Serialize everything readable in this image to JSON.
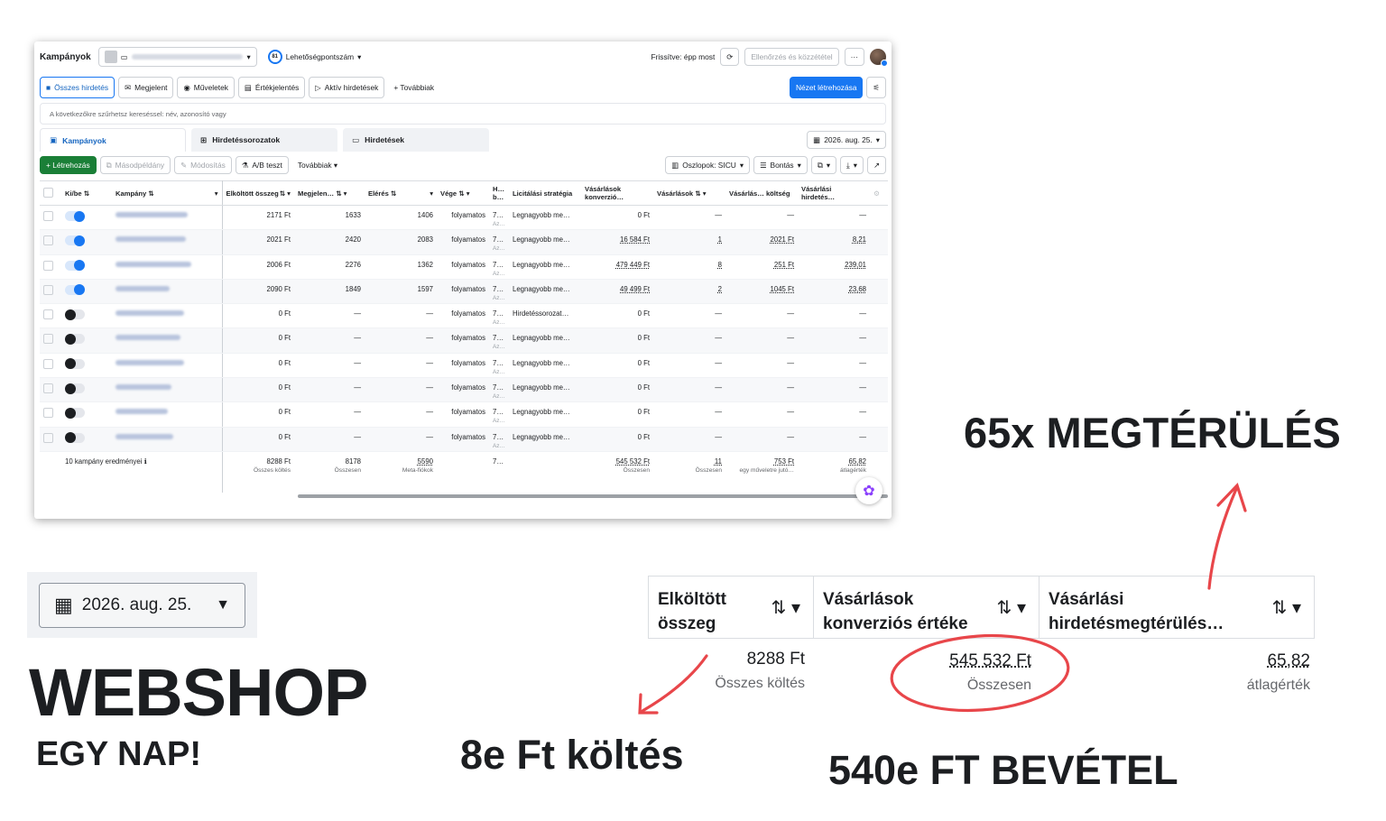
{
  "app": {
    "title": "Kampányok",
    "score_number": "81",
    "score_label": "Lehetőségpontszám",
    "refreshed": "Frissítve: épp most",
    "review_button": "Ellenőrzés és közzététel",
    "more_button": "···"
  },
  "filter_bar": {
    "all_ads": "Összes hirdetés",
    "appeared": "Megjelent",
    "actions": "Műveletek",
    "reports": "Értékjelentés",
    "active_ads": "Aktív hirdetések",
    "more": "+ Továbbiak",
    "create_view": "Nézet létrehozása"
  },
  "search": {
    "placeholder": "A következőkre szűrhetsz kereséssel: név, azonosító vagy"
  },
  "tabs": {
    "campaigns": "Kampányok",
    "adsets": "Hirdetéssorozatok",
    "ads": "Hirdetések",
    "date": "2026. aug. 25."
  },
  "toolbar": {
    "create": "+ Létrehozás",
    "duplicate": "Másodpéldány",
    "edit": "Módosítás",
    "ab_test": "A/B teszt",
    "more": "Továbbiak",
    "columns": "Oszlopok: SICU",
    "breakdown": "Bontás"
  },
  "table": {
    "headers": [
      "Ki/be",
      "Kampány",
      "Elköltött összeg",
      "Megjelen…",
      "Elérés",
      "Vége",
      "H… b…",
      "Licitálási stratégia",
      "Vásárlások konverzió…",
      "Vásárlások",
      "Vásárlás… költség",
      "Vásárlási hirdetés…"
    ],
    "rows": [
      {
        "on": true,
        "spend": "2171 Ft",
        "impr": "1633",
        "reach": "1406",
        "end": "folyamatos",
        "h": "7…",
        "bid": "Legnagyobb me…",
        "conv": "0 Ft",
        "purch": "—",
        "cost": "—",
        "roas": "—"
      },
      {
        "on": true,
        "spend": "2021 Ft",
        "impr": "2420",
        "reach": "2083",
        "end": "folyamatos",
        "h": "7…",
        "bid": "Legnagyobb me…",
        "conv": "16 584 Ft",
        "purch": "1",
        "cost": "2021 Ft",
        "roas": "8,21"
      },
      {
        "on": true,
        "spend": "2006 Ft",
        "impr": "2276",
        "reach": "1362",
        "end": "folyamatos",
        "h": "7…",
        "bid": "Legnagyobb me…",
        "conv": "479 449 Ft",
        "purch": "8",
        "cost": "251 Ft",
        "roas": "239,01"
      },
      {
        "on": true,
        "spend": "2090 Ft",
        "impr": "1849",
        "reach": "1597",
        "end": "folyamatos",
        "h": "7…",
        "bid": "Legnagyobb me…",
        "conv": "49 499 Ft",
        "purch": "2",
        "cost": "1045 Ft",
        "roas": "23,68"
      },
      {
        "on": false,
        "spend": "0 Ft",
        "impr": "—",
        "reach": "—",
        "end": "folyamatos",
        "h": "7…",
        "bid": "Hirdetéssorozat…",
        "conv": "0 Ft",
        "purch": "—",
        "cost": "—",
        "roas": "—"
      },
      {
        "on": false,
        "spend": "0 Ft",
        "impr": "—",
        "reach": "—",
        "end": "folyamatos",
        "h": "7…",
        "bid": "Legnagyobb me…",
        "conv": "0 Ft",
        "purch": "—",
        "cost": "—",
        "roas": "—"
      },
      {
        "on": false,
        "spend": "0 Ft",
        "impr": "—",
        "reach": "—",
        "end": "folyamatos",
        "h": "7…",
        "bid": "Legnagyobb me…",
        "conv": "0 Ft",
        "purch": "—",
        "cost": "—",
        "roas": "—"
      },
      {
        "on": false,
        "spend": "0 Ft",
        "impr": "—",
        "reach": "—",
        "end": "folyamatos",
        "h": "7…",
        "bid": "Legnagyobb me…",
        "conv": "0 Ft",
        "purch": "—",
        "cost": "—",
        "roas": "—"
      },
      {
        "on": false,
        "spend": "0 Ft",
        "impr": "—",
        "reach": "—",
        "end": "folyamatos",
        "h": "7…",
        "bid": "Legnagyobb me…",
        "conv": "0 Ft",
        "purch": "—",
        "cost": "—",
        "roas": "—"
      },
      {
        "on": false,
        "spend": "0 Ft",
        "impr": "—",
        "reach": "—",
        "end": "folyamatos",
        "h": "7…",
        "bid": "Legnagyobb me…",
        "conv": "0 Ft",
        "purch": "—",
        "cost": "—",
        "roas": "—"
      }
    ],
    "summary": {
      "label": "10 kampány eredményei",
      "spend": "8288 Ft",
      "spend_sub": "Összes költés",
      "impr": "8178",
      "impr_sub": "Összesen",
      "reach": "5590",
      "reach_sub": "Meta-fiókok",
      "h": "7…",
      "conv": "545 532 Ft",
      "conv_sub": "Összesen",
      "purch": "11",
      "purch_sub": "Összesen",
      "cost": "753 Ft",
      "cost_sub": "egy műveletre jutó…",
      "roas": "65,82",
      "roas_sub": "átlagérték"
    }
  },
  "zoom": {
    "date": "2026. aug. 25.",
    "col1_title": "Elköltött összeg",
    "col2_title": "Vásárlások konverziós értéke",
    "col3_title": "Vásárlási hirdetésmegtérülés…",
    "col1_value": "8288 Ft",
    "col1_sub": "Összes költés",
    "col2_value": "545 532 Ft",
    "col2_sub": "Összesen",
    "col3_value": "65,82",
    "col3_sub": "átlagérték",
    "sort_glyph": "⇅"
  },
  "overlay": {
    "webshop": "WEBSHOP",
    "egy_nap": "EGY NAP!",
    "spend": "8e Ft költés",
    "revenue": "540e FT BEVÉTEL",
    "roi": "65x MEGTÉRÜLÉS"
  },
  "colors": {
    "accent": "#1877f2",
    "annotation_red": "#e8464a",
    "create_green": "#1a7f37"
  }
}
